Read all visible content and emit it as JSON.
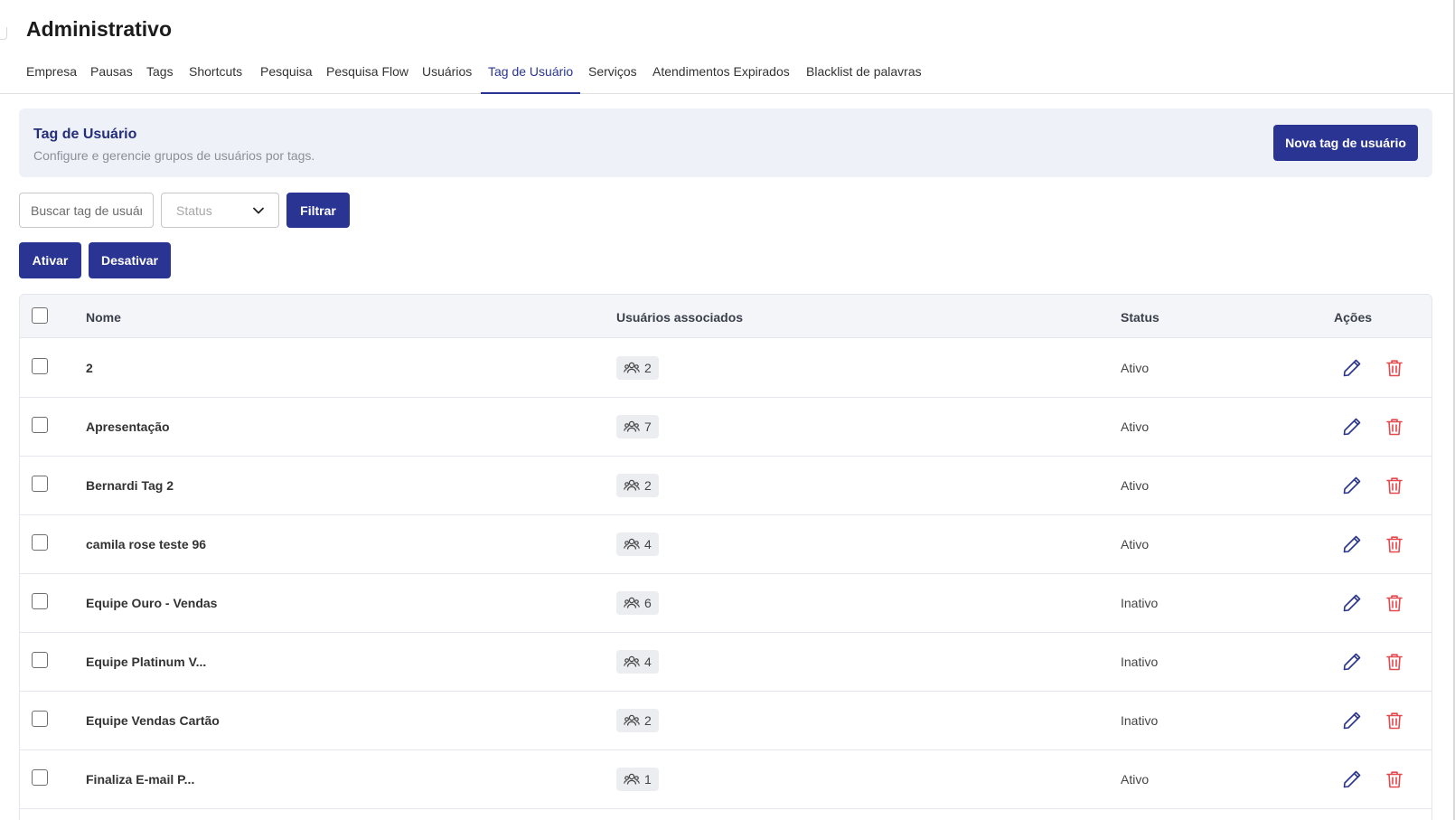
{
  "page": {
    "title": "Administrativo"
  },
  "tabs": [
    {
      "label": "Empresa",
      "active": false
    },
    {
      "label": "Pausas",
      "active": false
    },
    {
      "label": "Tags",
      "active": false
    },
    {
      "label": "Shortcuts",
      "active": false
    },
    {
      "label": "Pesquisa",
      "active": false
    },
    {
      "label": "Pesquisa Flow",
      "active": false
    },
    {
      "label": "Usuários",
      "active": false
    },
    {
      "label": "Tag de Usuário",
      "active": true
    },
    {
      "label": "Serviços",
      "active": false
    },
    {
      "label": "Atendimentos Expirados",
      "active": false
    },
    {
      "label": "Blacklist de palavras",
      "active": false
    }
  ],
  "banner": {
    "title": "Tag de Usuário",
    "subtitle": "Configure e gerencie grupos de usuários por tags.",
    "new_button": "Nova tag de usuário"
  },
  "filters": {
    "search_placeholder": "Buscar tag de usuário",
    "status_placeholder": "Status",
    "filter_button": "Filtrar"
  },
  "bulk_actions": {
    "activate": "Ativar",
    "deactivate": "Desativar"
  },
  "table": {
    "headers": {
      "name": "Nome",
      "users": "Usuários associados",
      "status": "Status",
      "actions": "Ações"
    },
    "rows": [
      {
        "name": "2",
        "users": "2",
        "status": "Ativo"
      },
      {
        "name": "Apresentação",
        "users": "7",
        "status": "Ativo"
      },
      {
        "name": "Bernardi Tag 2",
        "users": "2",
        "status": "Ativo"
      },
      {
        "name": "camila rose teste 96",
        "users": "4",
        "status": "Ativo"
      },
      {
        "name": "Equipe Ouro - Vendas",
        "users": "6",
        "status": "Inativo"
      },
      {
        "name": "Equipe Platinum V...",
        "users": "4",
        "status": "Inativo"
      },
      {
        "name": "Equipe Vendas Cartão",
        "users": "2",
        "status": "Inativo"
      },
      {
        "name": "Finaliza E-mail P...",
        "users": "1",
        "status": "Ativo"
      }
    ]
  },
  "colors": {
    "primary": "#2a3593",
    "danger": "#e5484d",
    "banner_bg": "#eef2f8",
    "badge_bg": "#ebedf1"
  },
  "icons": {
    "users": "users-group-icon",
    "edit": "pencil-icon",
    "delete": "trash-icon",
    "chevron": "chevron-down-icon"
  }
}
